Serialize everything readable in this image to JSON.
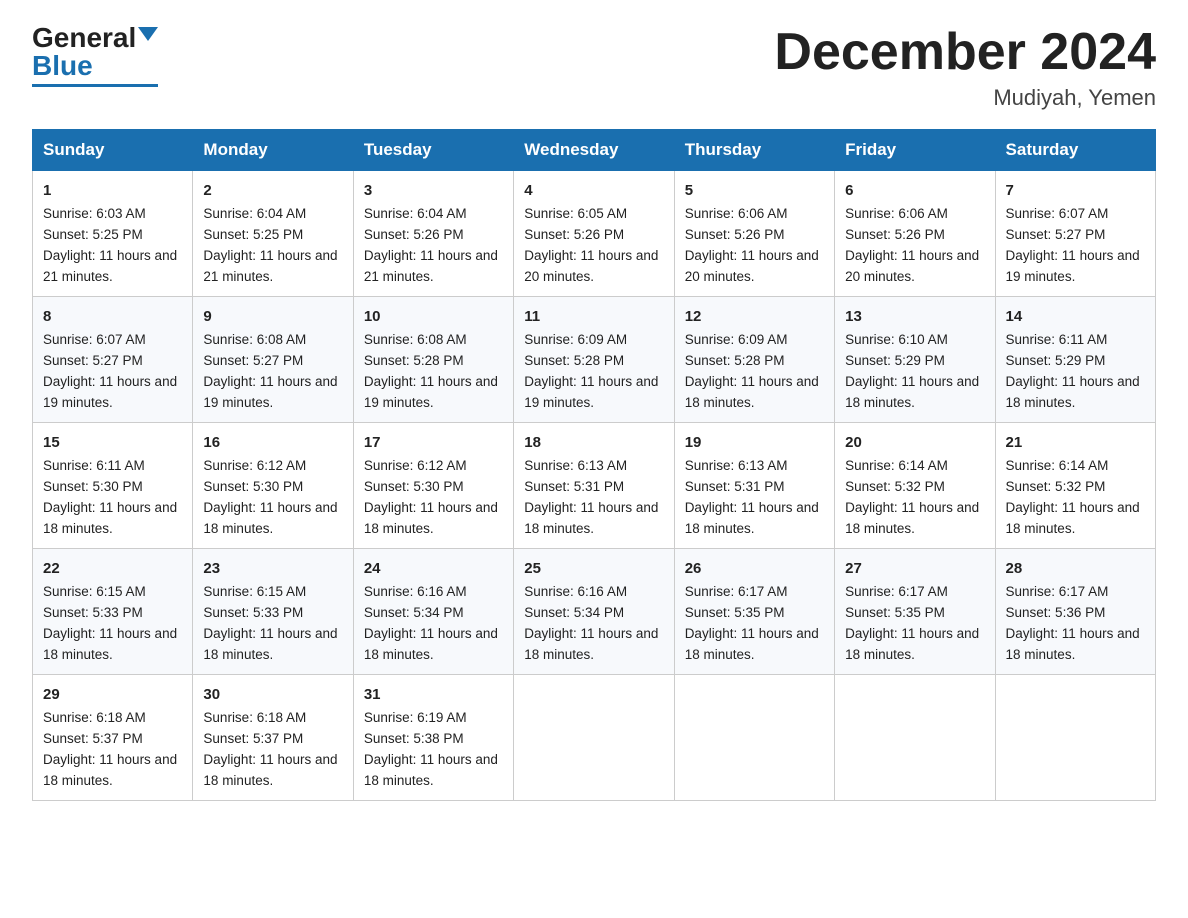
{
  "logo": {
    "general": "General",
    "blue": "Blue"
  },
  "title": "December 2024",
  "location": "Mudiyah, Yemen",
  "days_header": [
    "Sunday",
    "Monday",
    "Tuesday",
    "Wednesday",
    "Thursday",
    "Friday",
    "Saturday"
  ],
  "weeks": [
    [
      {
        "day": "1",
        "sunrise": "6:03 AM",
        "sunset": "5:25 PM",
        "daylight": "11 hours and 21 minutes."
      },
      {
        "day": "2",
        "sunrise": "6:04 AM",
        "sunset": "5:25 PM",
        "daylight": "11 hours and 21 minutes."
      },
      {
        "day": "3",
        "sunrise": "6:04 AM",
        "sunset": "5:26 PM",
        "daylight": "11 hours and 21 minutes."
      },
      {
        "day": "4",
        "sunrise": "6:05 AM",
        "sunset": "5:26 PM",
        "daylight": "11 hours and 20 minutes."
      },
      {
        "day": "5",
        "sunrise": "6:06 AM",
        "sunset": "5:26 PM",
        "daylight": "11 hours and 20 minutes."
      },
      {
        "day": "6",
        "sunrise": "6:06 AM",
        "sunset": "5:26 PM",
        "daylight": "11 hours and 20 minutes."
      },
      {
        "day": "7",
        "sunrise": "6:07 AM",
        "sunset": "5:27 PM",
        "daylight": "11 hours and 19 minutes."
      }
    ],
    [
      {
        "day": "8",
        "sunrise": "6:07 AM",
        "sunset": "5:27 PM",
        "daylight": "11 hours and 19 minutes."
      },
      {
        "day": "9",
        "sunrise": "6:08 AM",
        "sunset": "5:27 PM",
        "daylight": "11 hours and 19 minutes."
      },
      {
        "day": "10",
        "sunrise": "6:08 AM",
        "sunset": "5:28 PM",
        "daylight": "11 hours and 19 minutes."
      },
      {
        "day": "11",
        "sunrise": "6:09 AM",
        "sunset": "5:28 PM",
        "daylight": "11 hours and 19 minutes."
      },
      {
        "day": "12",
        "sunrise": "6:09 AM",
        "sunset": "5:28 PM",
        "daylight": "11 hours and 18 minutes."
      },
      {
        "day": "13",
        "sunrise": "6:10 AM",
        "sunset": "5:29 PM",
        "daylight": "11 hours and 18 minutes."
      },
      {
        "day": "14",
        "sunrise": "6:11 AM",
        "sunset": "5:29 PM",
        "daylight": "11 hours and 18 minutes."
      }
    ],
    [
      {
        "day": "15",
        "sunrise": "6:11 AM",
        "sunset": "5:30 PM",
        "daylight": "11 hours and 18 minutes."
      },
      {
        "day": "16",
        "sunrise": "6:12 AM",
        "sunset": "5:30 PM",
        "daylight": "11 hours and 18 minutes."
      },
      {
        "day": "17",
        "sunrise": "6:12 AM",
        "sunset": "5:30 PM",
        "daylight": "11 hours and 18 minutes."
      },
      {
        "day": "18",
        "sunrise": "6:13 AM",
        "sunset": "5:31 PM",
        "daylight": "11 hours and 18 minutes."
      },
      {
        "day": "19",
        "sunrise": "6:13 AM",
        "sunset": "5:31 PM",
        "daylight": "11 hours and 18 minutes."
      },
      {
        "day": "20",
        "sunrise": "6:14 AM",
        "sunset": "5:32 PM",
        "daylight": "11 hours and 18 minutes."
      },
      {
        "day": "21",
        "sunrise": "6:14 AM",
        "sunset": "5:32 PM",
        "daylight": "11 hours and 18 minutes."
      }
    ],
    [
      {
        "day": "22",
        "sunrise": "6:15 AM",
        "sunset": "5:33 PM",
        "daylight": "11 hours and 18 minutes."
      },
      {
        "day": "23",
        "sunrise": "6:15 AM",
        "sunset": "5:33 PM",
        "daylight": "11 hours and 18 minutes."
      },
      {
        "day": "24",
        "sunrise": "6:16 AM",
        "sunset": "5:34 PM",
        "daylight": "11 hours and 18 minutes."
      },
      {
        "day": "25",
        "sunrise": "6:16 AM",
        "sunset": "5:34 PM",
        "daylight": "11 hours and 18 minutes."
      },
      {
        "day": "26",
        "sunrise": "6:17 AM",
        "sunset": "5:35 PM",
        "daylight": "11 hours and 18 minutes."
      },
      {
        "day": "27",
        "sunrise": "6:17 AM",
        "sunset": "5:35 PM",
        "daylight": "11 hours and 18 minutes."
      },
      {
        "day": "28",
        "sunrise": "6:17 AM",
        "sunset": "5:36 PM",
        "daylight": "11 hours and 18 minutes."
      }
    ],
    [
      {
        "day": "29",
        "sunrise": "6:18 AM",
        "sunset": "5:37 PM",
        "daylight": "11 hours and 18 minutes."
      },
      {
        "day": "30",
        "sunrise": "6:18 AM",
        "sunset": "5:37 PM",
        "daylight": "11 hours and 18 minutes."
      },
      {
        "day": "31",
        "sunrise": "6:19 AM",
        "sunset": "5:38 PM",
        "daylight": "11 hours and 18 minutes."
      },
      null,
      null,
      null,
      null
    ]
  ]
}
